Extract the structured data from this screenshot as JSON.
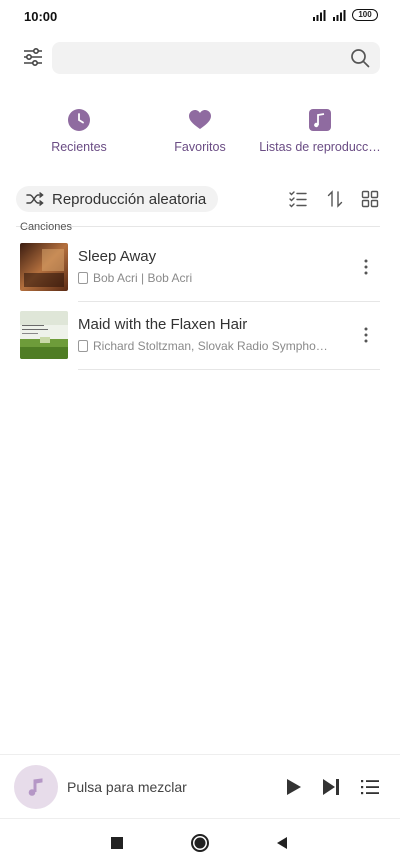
{
  "status_bar": {
    "time": "10:00",
    "battery": "100"
  },
  "search": {
    "value": "",
    "placeholder": ""
  },
  "quick_access": [
    {
      "label": "Recientes",
      "icon": "clock-icon"
    },
    {
      "label": "Favoritos",
      "icon": "heart-icon"
    },
    {
      "label": "Listas de reproducc…",
      "icon": "playlist-icon"
    }
  ],
  "shuffle": {
    "label": "Reproducción aleatoria",
    "icon": "shuffle-icon"
  },
  "toolbar_icons": [
    "multi-select-icon",
    "sort-icon",
    "grid-view-icon"
  ],
  "section": {
    "label": "Canciones"
  },
  "songs": [
    {
      "title": "Sleep Away",
      "artist": "Bob Acri | Bob Acri"
    },
    {
      "title": "Maid with the Flaxen Hair",
      "artist": "Richard Stoltzman, Slovak Radio Sympho…"
    }
  ],
  "player": {
    "prompt": "Pulsa para mezclar"
  },
  "colors": {
    "accent": "#8f6ba0",
    "accent_light": "#e7dcea",
    "accent_text": "#6a4c84"
  }
}
